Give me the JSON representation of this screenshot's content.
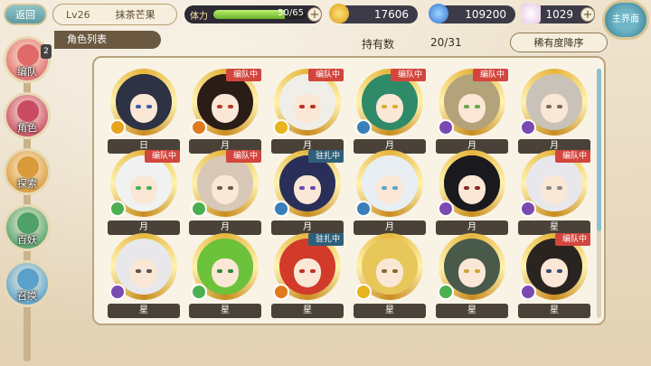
{
  "topbar": {
    "back_label": "返回",
    "level": "Lv26",
    "player_name": "抹茶芒果",
    "stamina_label": "体力",
    "stamina_value": "50/65",
    "stamina_fraction": 0.77,
    "coins": "17606",
    "souls": "109200",
    "jade": "1029",
    "plus": "+",
    "home_label": "主界面"
  },
  "list_header": {
    "tab": "角色列表",
    "owned_label": "持有数",
    "owned_value": "20/31",
    "sort_label": "稀有度降序"
  },
  "nav": {
    "items": [
      {
        "label": "编队",
        "badge": "2",
        "color": "#e06a6a"
      },
      {
        "label": "角色",
        "color": "#c94a62"
      },
      {
        "label": "探索",
        "color": "#d99a3a"
      },
      {
        "label": "百妖",
        "color": "#4fa06a"
      },
      {
        "label": "召唤",
        "color": "#5aa0c8"
      }
    ]
  },
  "characters": [
    {
      "name": "日",
      "tag": "",
      "hair": "#2d3244",
      "eye": "#3b5fa8",
      "elem": "#e6a51e"
    },
    {
      "name": "月",
      "tag": "编队中",
      "hair": "#2a1c16",
      "eye": "#b23a2a",
      "elem": "#e07a1e"
    },
    {
      "name": "月",
      "tag": "编队中",
      "hair": "#f0eee8",
      "eye": "#c03020",
      "elem": "#e6b51e"
    },
    {
      "name": "月",
      "tag": "编队中",
      "hair": "#2f8a6a",
      "eye": "#d9b12a",
      "elem": "#3a7fb8"
    },
    {
      "name": "月",
      "tag": "编队中",
      "hair": "#b3a37a",
      "eye": "#6aa84f",
      "elem": "#7a4ab0"
    },
    {
      "name": "月",
      "tag": "",
      "hair": "#c9c2b8",
      "eye": "#7a6a5a",
      "elem": "#7a4ab0"
    },
    {
      "name": "月",
      "tag": "编队中",
      "hair": "#f0f2f2",
      "eye": "#4caf50",
      "elem": "#4caf50"
    },
    {
      "name": "月",
      "tag": "编队中",
      "hair": "#d8c8b8",
      "eye": "#6a5a4a",
      "elem": "#4caf50"
    },
    {
      "name": "月",
      "tag": "驻扎中",
      "hair": "#2a2f5a",
      "eye": "#6a4ab0",
      "elem": "#3a7fb8"
    },
    {
      "name": "月",
      "tag": "",
      "hair": "#e8eef2",
      "eye": "#5aa8c8",
      "elem": "#3a7fb8"
    },
    {
      "name": "月",
      "tag": "",
      "hair": "#1a1a1e",
      "eye": "#8a2a2a",
      "elem": "#7a4ab0"
    },
    {
      "name": "星",
      "tag": "编队中",
      "hair": "#e8e8ec",
      "eye": "#888888",
      "elem": "#7a4ab0"
    },
    {
      "name": "星",
      "tag": "",
      "hair": "#e8e8ea",
      "eye": "#555555",
      "elem": "#7a4ab0"
    },
    {
      "name": "星",
      "tag": "",
      "hair": "#6cc23a",
      "eye": "#2a8a3a",
      "elem": "#4caf50"
    },
    {
      "name": "星",
      "tag": "驻扎中",
      "hair": "#d23a2a",
      "eye": "#c03020",
      "elem": "#e07a1e"
    },
    {
      "name": "星",
      "tag": "",
      "hair": "#e8c75a",
      "eye": "#8a6a2a",
      "elem": "#e6b51e"
    },
    {
      "name": "星",
      "tag": "",
      "hair": "#4a5a4a",
      "eye": "#c8a83a",
      "elem": "#4caf50"
    },
    {
      "name": "星",
      "tag": "编队中",
      "hair": "#2a2420",
      "eye": "#3a4a7a",
      "elem": "#7a4ab0"
    }
  ]
}
